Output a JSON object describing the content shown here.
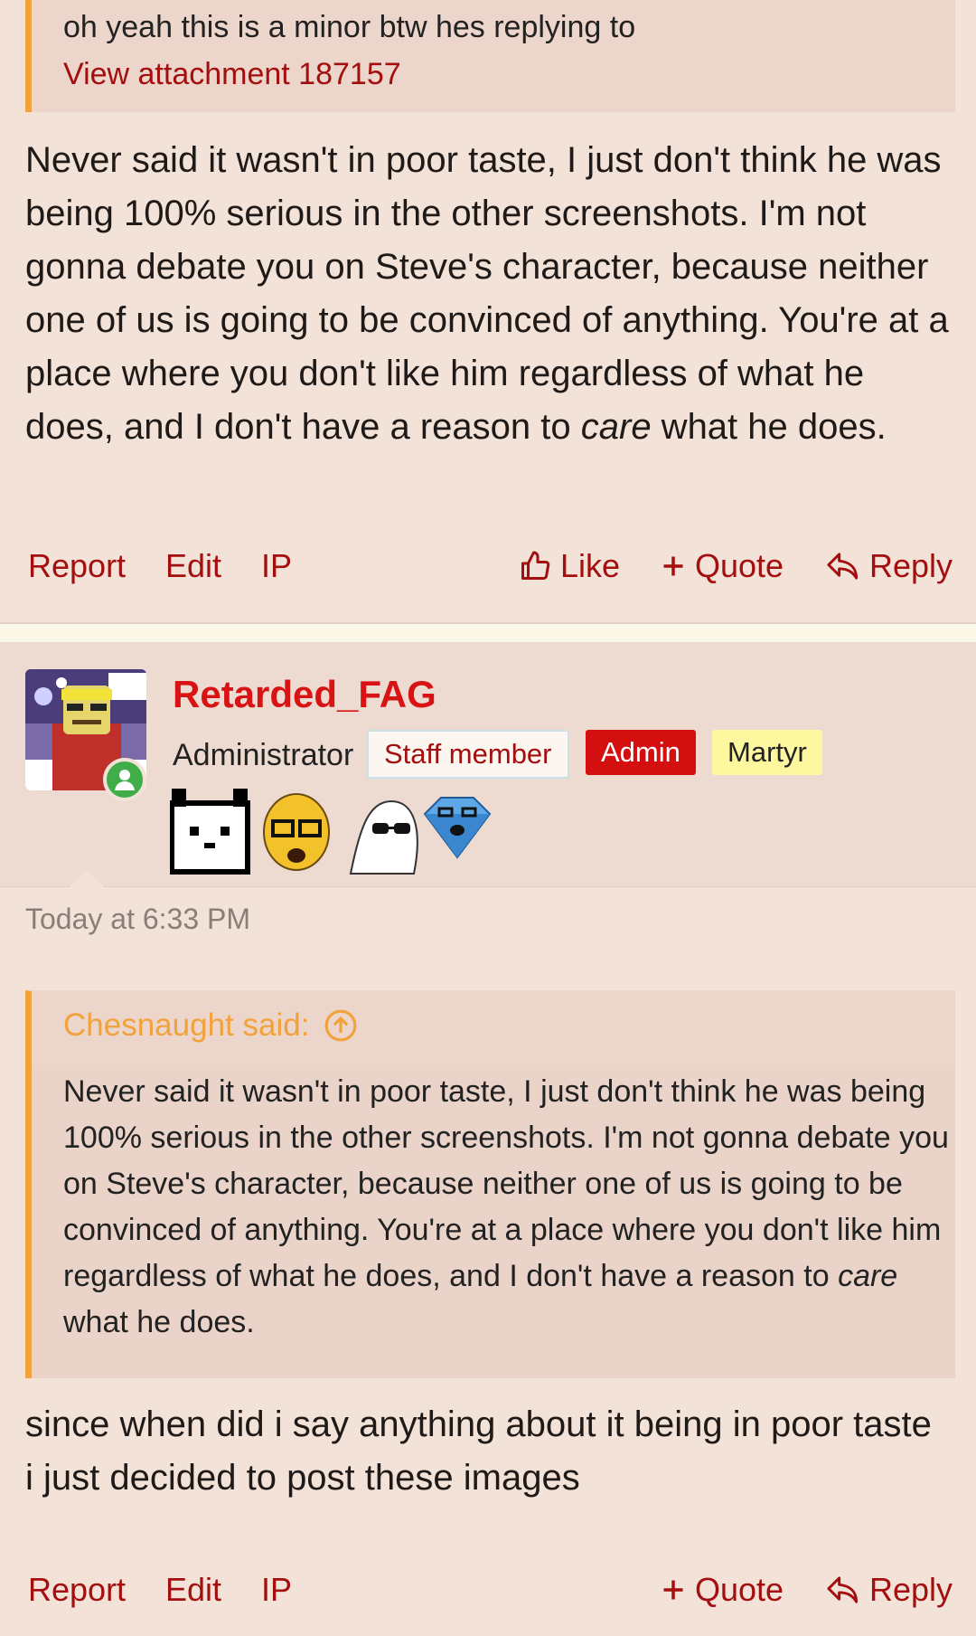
{
  "post1": {
    "quote": {
      "text": "oh yeah this is a minor btw hes replying to",
      "attachment_link": "View attachment 187157"
    },
    "body": {
      "part1": "Never said it wasn't in poor taste, I just don't think he was being 100% serious in the other screenshots. I'm not gonna debate you on Steve's character, because neither one of us is going to be convinced of anything. You're at a place where you don't like him regardless of what he does, and I don't have a reason to ",
      "emphasis": "care",
      "part2": " what he does."
    },
    "actions": {
      "report": "Report",
      "edit": "Edit",
      "ip": "IP",
      "like": "Like",
      "quote": "Quote",
      "reply": "Reply"
    }
  },
  "post2": {
    "user": {
      "name": "Retarded_FAG",
      "title": "Administrator",
      "badges": [
        "Staff member",
        "Admin",
        "Martyr"
      ],
      "avatar_icon": "user-avatar-image",
      "status": "online"
    },
    "trophies": [
      "pixel-cat-icon",
      "glasses-soyjak-icon",
      "sunglasses-soyjak-icon",
      "blue-diamond-icon"
    ],
    "timestamp": "Today at 6:33 PM",
    "quote": {
      "author": "Chesnaught said:",
      "text_part1": "Never said it wasn't in poor taste, I just don't think he was being 100% serious in the other screenshots. I'm not gonna debate you on Steve's character, because neither one of us is going to be convinced of anything. You're at a place where you don't like him regardless of what he does, and I don't have a reason to ",
      "emphasis": "care",
      "text_part2": " what he does."
    },
    "body": "since when did i say anything about it being in poor taste i just decided to post these images",
    "actions": {
      "report": "Report",
      "edit": "Edit",
      "ip": "IP",
      "quote": "Quote",
      "reply": "Reply"
    }
  },
  "colors": {
    "link": "#a30f0f",
    "quote_border": "#f2a23a",
    "username": "#d81313",
    "admin_badge": "#d40f0f",
    "martyr_badge": "#fdf7a0",
    "post_bg": "#f2e2d8",
    "online": "#3fae49"
  }
}
